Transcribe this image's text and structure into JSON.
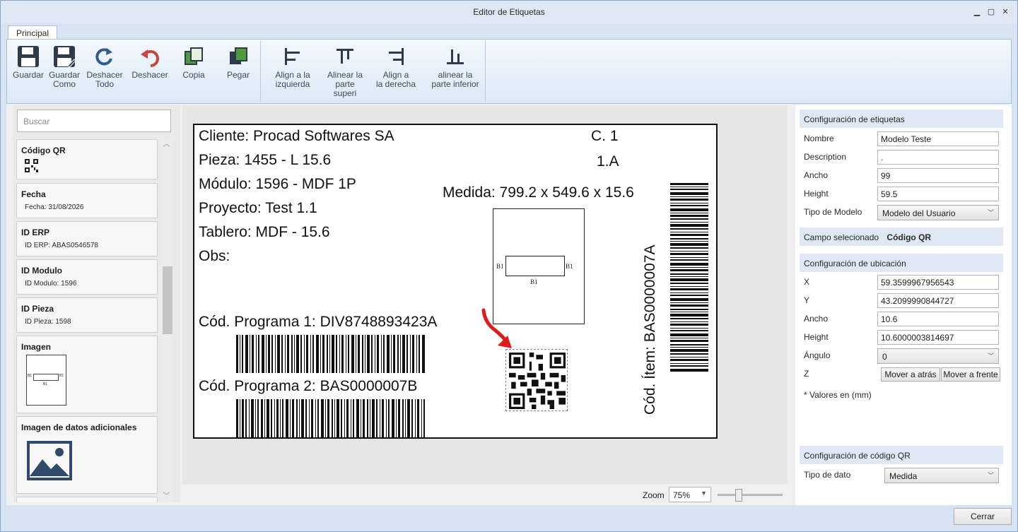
{
  "window": {
    "title": "Editor de Etiquetas",
    "minimize": "▁",
    "maximize": "▢",
    "close": "✕"
  },
  "ribbon": {
    "tab": "Principal",
    "buttons": {
      "save": [
        "Guardar"
      ],
      "save_as": [
        "Guardar",
        "Como"
      ],
      "undo_all": [
        "Deshacer",
        "Todo"
      ],
      "undo": [
        "Deshacer"
      ],
      "copy": [
        "Copia"
      ],
      "paste": [
        "Pegar"
      ],
      "align_left": [
        "Align a la",
        "izquierda"
      ],
      "align_top": [
        "Alinear la",
        "parte superi"
      ],
      "align_right": [
        "Align a",
        "la derecha"
      ],
      "align_bottom": [
        "alinear la",
        "parte inferior"
      ]
    }
  },
  "palette": {
    "search_placeholder": "Buscar",
    "items": [
      {
        "title": "Código QR",
        "value": ""
      },
      {
        "title": "Fecha",
        "value": "Fecha: 31/08/2026"
      },
      {
        "title": "ID ERP",
        "value": "ID ERP: ABAS0546578"
      },
      {
        "title": "ID Modulo",
        "value": "ID Modulo: 1596"
      },
      {
        "title": "ID Pieza",
        "value": "ID Pieza: 1598"
      },
      {
        "title": "Imagen",
        "value": ""
      },
      {
        "title": "Imagen de datos adicionales",
        "value": ""
      }
    ],
    "thumb_labels": {
      "b1": "B1"
    }
  },
  "label": {
    "cliente": "Cliente: Procad Softwares SA",
    "pieza": "Pieza: 1455 - L 15.6",
    "modulo": "Módulo: 1596 - MDF 1P",
    "proyecto": "Proyecto: Test 1.1",
    "tablero": "Tablero: MDF - 15.6",
    "obs": "Obs:",
    "c1": "C. 1",
    "one_a": "1.A",
    "medida": "Medida: 799.2 x 549.6 x 15.6",
    "prog1": "Cód. Programa 1: DIV8748893423A",
    "prog2": "Cód. Programa 2: BAS0000007B",
    "item_vertical": "Cód. Ítem: BAS0000007A",
    "edge_b1": "B1"
  },
  "zoom": {
    "label": "Zoom",
    "value": "75%",
    "level": 0.3
  },
  "properties": {
    "label_config": {
      "header": "Configuración de etiquetas",
      "nombre_label": "Nombre",
      "nombre": "Modelo Teste",
      "description_label": "Description",
      "description": ".",
      "ancho_label": "Ancho",
      "ancho": "99",
      "height_label": "Height",
      "height": "59.5",
      "tipo_label": "Tipo de Modelo",
      "tipo": "Modelo del Usuario"
    },
    "selected": {
      "label": "Campo selecionado",
      "value": "Código QR"
    },
    "location": {
      "header": "Configuración de ubicación",
      "x_label": "X",
      "x": "59.3599967956543",
      "y_label": "Y",
      "y": "43.2099990844727",
      "ancho_label": "Ancho",
      "ancho": "10.6",
      "height_label": "Height",
      "height": "10.6000003814697",
      "angulo_label": "Ángulo",
      "angulo": "0",
      "z_label": "Z",
      "back_button": "Mover a atrás",
      "front_button": "Mover a frente",
      "note": "* Valores en (mm)"
    },
    "qr_config": {
      "header": "Configuración de código QR",
      "tipo_label": "Tipo de dato",
      "tipo": "Medida"
    }
  },
  "footer": {
    "close_button": "Cerrar"
  },
  "colors": {
    "accent_red": "#e01b1b",
    "ribbon_blue": "#dce8f6",
    "header_blue": "#dfe8f4",
    "undo_red": "#c8463c",
    "copy_green": "#4f9a3c"
  }
}
